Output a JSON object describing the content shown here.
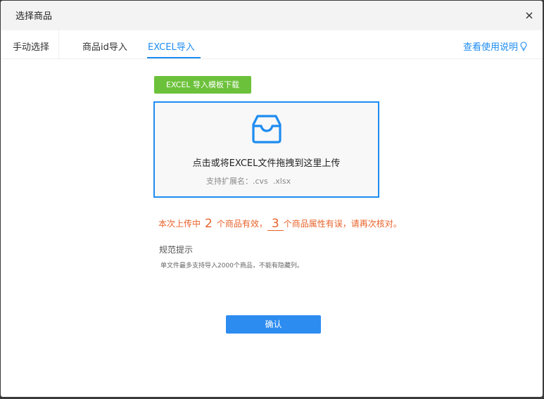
{
  "dialog": {
    "title": "选择商品",
    "close_icon": "close-icon"
  },
  "tabs": [
    {
      "label": "手动选择",
      "active": false
    },
    {
      "label": "商品id导入",
      "active": false
    },
    {
      "label": "EXCEL导入",
      "active": true
    }
  ],
  "help": {
    "label": "查看使用说明",
    "icon": "lightbulb-icon"
  },
  "download_button": "EXCEL 导入模板下载",
  "upload": {
    "icon": "inbox-icon",
    "prompt": "点击或将EXCEL文件拖拽到这里上传",
    "ext_label": "支持扩展名：",
    "ext_values": ".cvs  .xlsx"
  },
  "result": {
    "prefix": "本次上传中",
    "valid_count": "2",
    "middle": "个商品有效，",
    "invalid_count": "3",
    "suffix": "个商品属性有误，请再次核对。"
  },
  "spec": {
    "title": "规范提示",
    "desc": "单文件最多支持导入2000个商品，不能有隐藏列。"
  },
  "confirm_button": "确认",
  "colors": {
    "accent": "#1e8cf0",
    "download_green": "#6cc13a",
    "result_orange": "#e8622a"
  }
}
